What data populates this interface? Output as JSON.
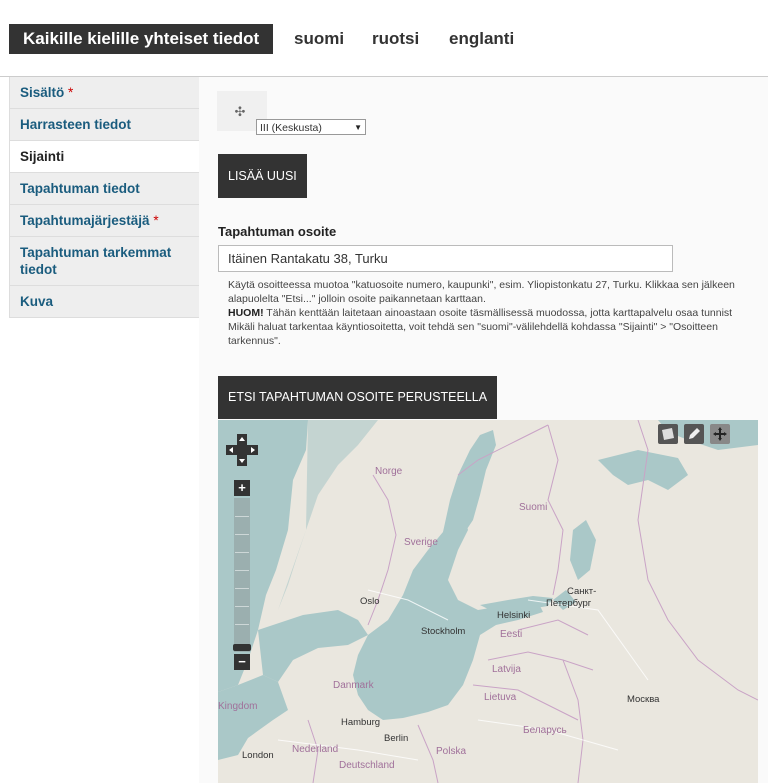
{
  "tabs": [
    {
      "label": "Kaikille kielille yhteiset tiedot"
    },
    {
      "label": "suomi"
    },
    {
      "label": "ruotsi"
    },
    {
      "label": "englanti"
    }
  ],
  "sidebar": {
    "items": [
      {
        "label": "Sisältö",
        "required": "*"
      },
      {
        "label": "Harrasteen tiedot"
      },
      {
        "label": "Sijainti"
      },
      {
        "label": "Tapahtuman tiedot"
      },
      {
        "label": "Tapahtumajärjestäjä",
        "required": "*"
      },
      {
        "label": "Tapahtuman tarkemmat tiedot"
      },
      {
        "label": "Kuva"
      }
    ]
  },
  "district_select": {
    "value": "III (Keskusta)"
  },
  "add_new_button": "LISÄÄ UUSI",
  "address": {
    "label": "Tapahtuman osoite",
    "value": "Itäinen Rantakatu 38, Turku",
    "help_line1": "Käytä osoitteessa muotoa \"katuosoite numero, kaupunki\", esim. Yliopistonkatu 27, Turku. Klikkaa sen jälkeen",
    "help_line2": "alapuolelta \"Etsi...\" jolloin osoite paikannetaan karttaan.",
    "help_huom": "HUOM!",
    "help_line3": " Tähän kenttään laitetaan ainoastaan osoite täsmällisessä muodossa, jotta karttapalvelu osaa tunnist",
    "help_line4": "Mikäli haluat tarkentaa käyntiosoitetta, voit tehdä sen \"suomi\"-välilehdellä kohdassa \"Sijainti\" > \"Osoitteen",
    "help_line5": "tarkennus\"."
  },
  "search_button": "ETSI TAPAHTUMAN OSOITE PERUSTEELLA",
  "map": {
    "labels": {
      "norge": "Norge",
      "suomi": "Suomi",
      "sverige": "Sverige",
      "oslo": "Oslo",
      "stockholm": "Stockholm",
      "helsinki": "Helsinki",
      "spb1": "Санкт-",
      "spb2": "Петербург",
      "eesti": "Eesti",
      "latvija": "Latvija",
      "danmark": "Danmark",
      "lietuva": "Lietuva",
      "moskva": "Москва",
      "kingdom": "Kingdom",
      "hamburg": "Hamburg",
      "berlin": "Berlin",
      "belarus": "Беларусь",
      "london": "London",
      "nederland": "Nederland",
      "polska": "Polska",
      "deutschland": "Deutschland"
    },
    "zoom_in": "+",
    "zoom_out": "−",
    "colors": {
      "water": "#aac8c8",
      "land": "#eae7df",
      "border": "#c9a3c6"
    }
  }
}
